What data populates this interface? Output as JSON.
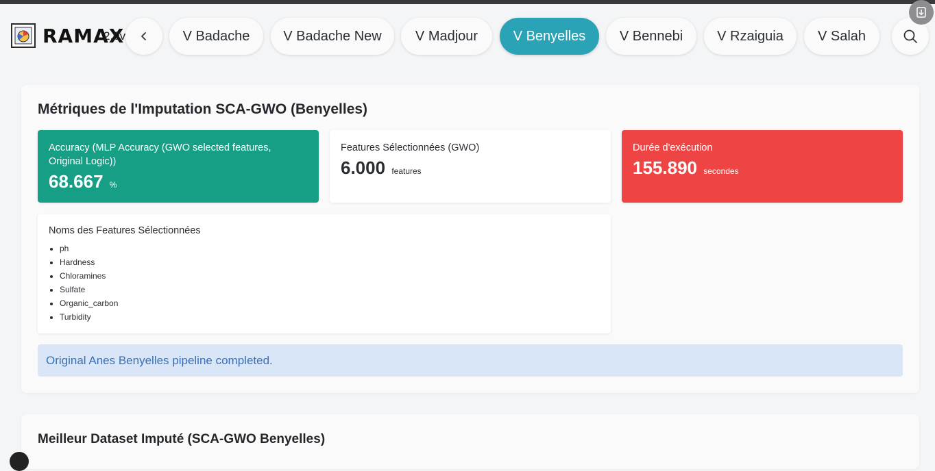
{
  "header": {
    "brand": "RAMAX",
    "version": "2.0v",
    "tabs": [
      {
        "label": "V Badache",
        "active": false
      },
      {
        "label": "V Badache New",
        "active": false
      },
      {
        "label": "V Madjour",
        "active": false
      },
      {
        "label": "V Benyelles",
        "active": true
      },
      {
        "label": "V Bennebi",
        "active": false
      },
      {
        "label": "V Rzaiguia",
        "active": false
      },
      {
        "label": "V Salah",
        "active": false
      }
    ],
    "icons": {
      "back": "chevron-left-icon",
      "search": "search-icon",
      "download": "download-icon",
      "logo": "logo-icon"
    }
  },
  "metrics_card": {
    "title": "Métriques de l'Imputation SCA-GWO (Benyelles)",
    "accuracy": {
      "label": "Accuracy (MLP Accuracy (GWO selected features, Original Logic))",
      "value": "68.667",
      "unit": "%"
    },
    "features": {
      "label": "Features Sélectionnées (GWO)",
      "value": "6.000",
      "unit": "features"
    },
    "duration": {
      "label": "Durée d'exécution",
      "value": "155.890",
      "unit": "secondes"
    },
    "feature_names": {
      "label": "Noms des Features Sélectionnées",
      "items": [
        "ph",
        "Hardness",
        "Chloramines",
        "Sulfate",
        "Organic_carbon",
        "Turbidity"
      ]
    },
    "alert": "Original Anes Benyelles pipeline completed."
  },
  "best_dataset_card": {
    "title": "Meilleur Dataset Imputé (SCA-GWO Benyelles)"
  },
  "colors": {
    "accent": "#2aa3b7",
    "success": "#179f86",
    "danger": "#ee4444",
    "info_bg": "#d9e6f8",
    "info_text": "#3a6fb5"
  }
}
